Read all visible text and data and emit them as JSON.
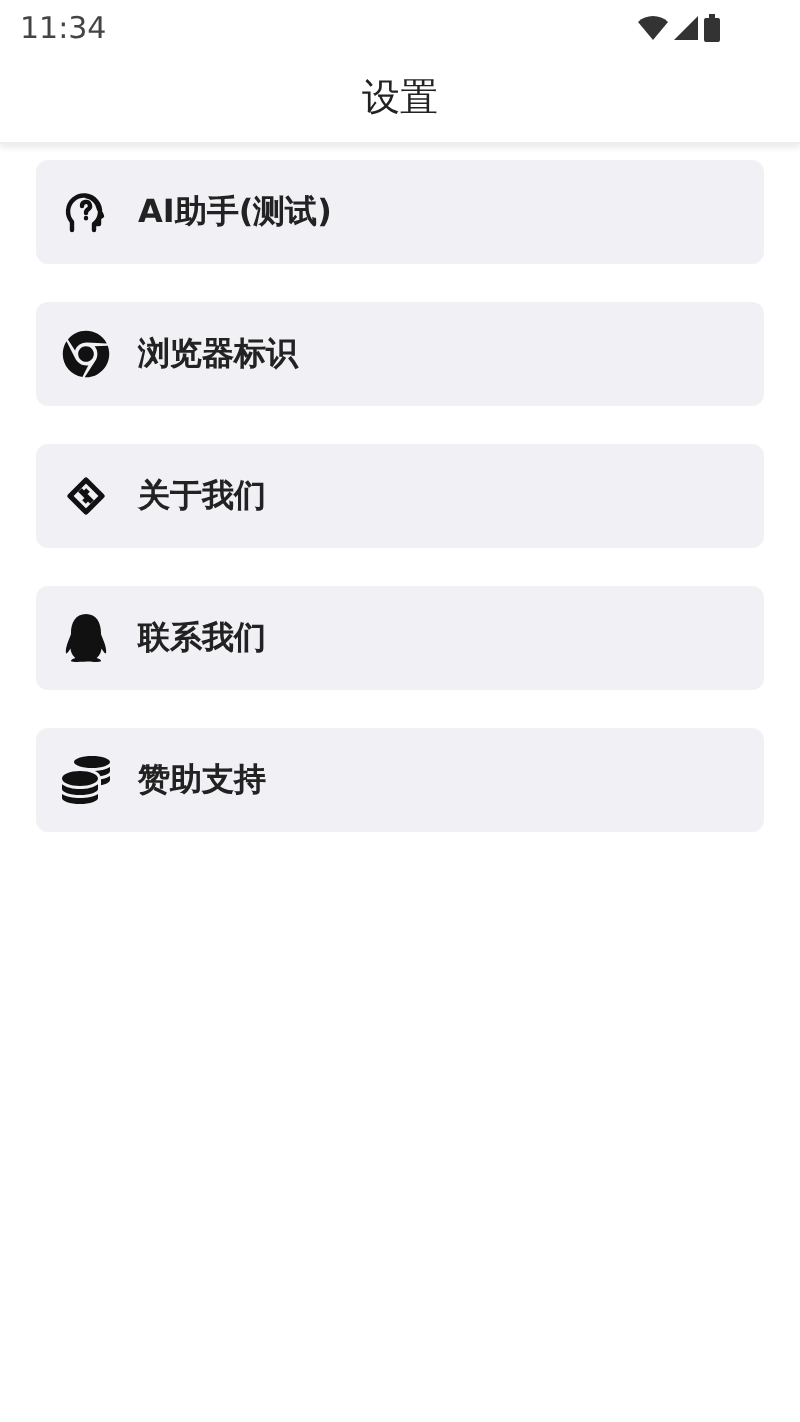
{
  "status_bar": {
    "time": "11:34"
  },
  "header": {
    "title": "设置"
  },
  "menu": [
    {
      "kind": "ai",
      "label": "AI助手(测试)"
    },
    {
      "kind": "browser",
      "label": "浏览器标识"
    },
    {
      "kind": "about",
      "label": "关于我们"
    },
    {
      "kind": "contact",
      "label": "联系我们"
    },
    {
      "kind": "donate",
      "label": "赞助支持"
    }
  ]
}
